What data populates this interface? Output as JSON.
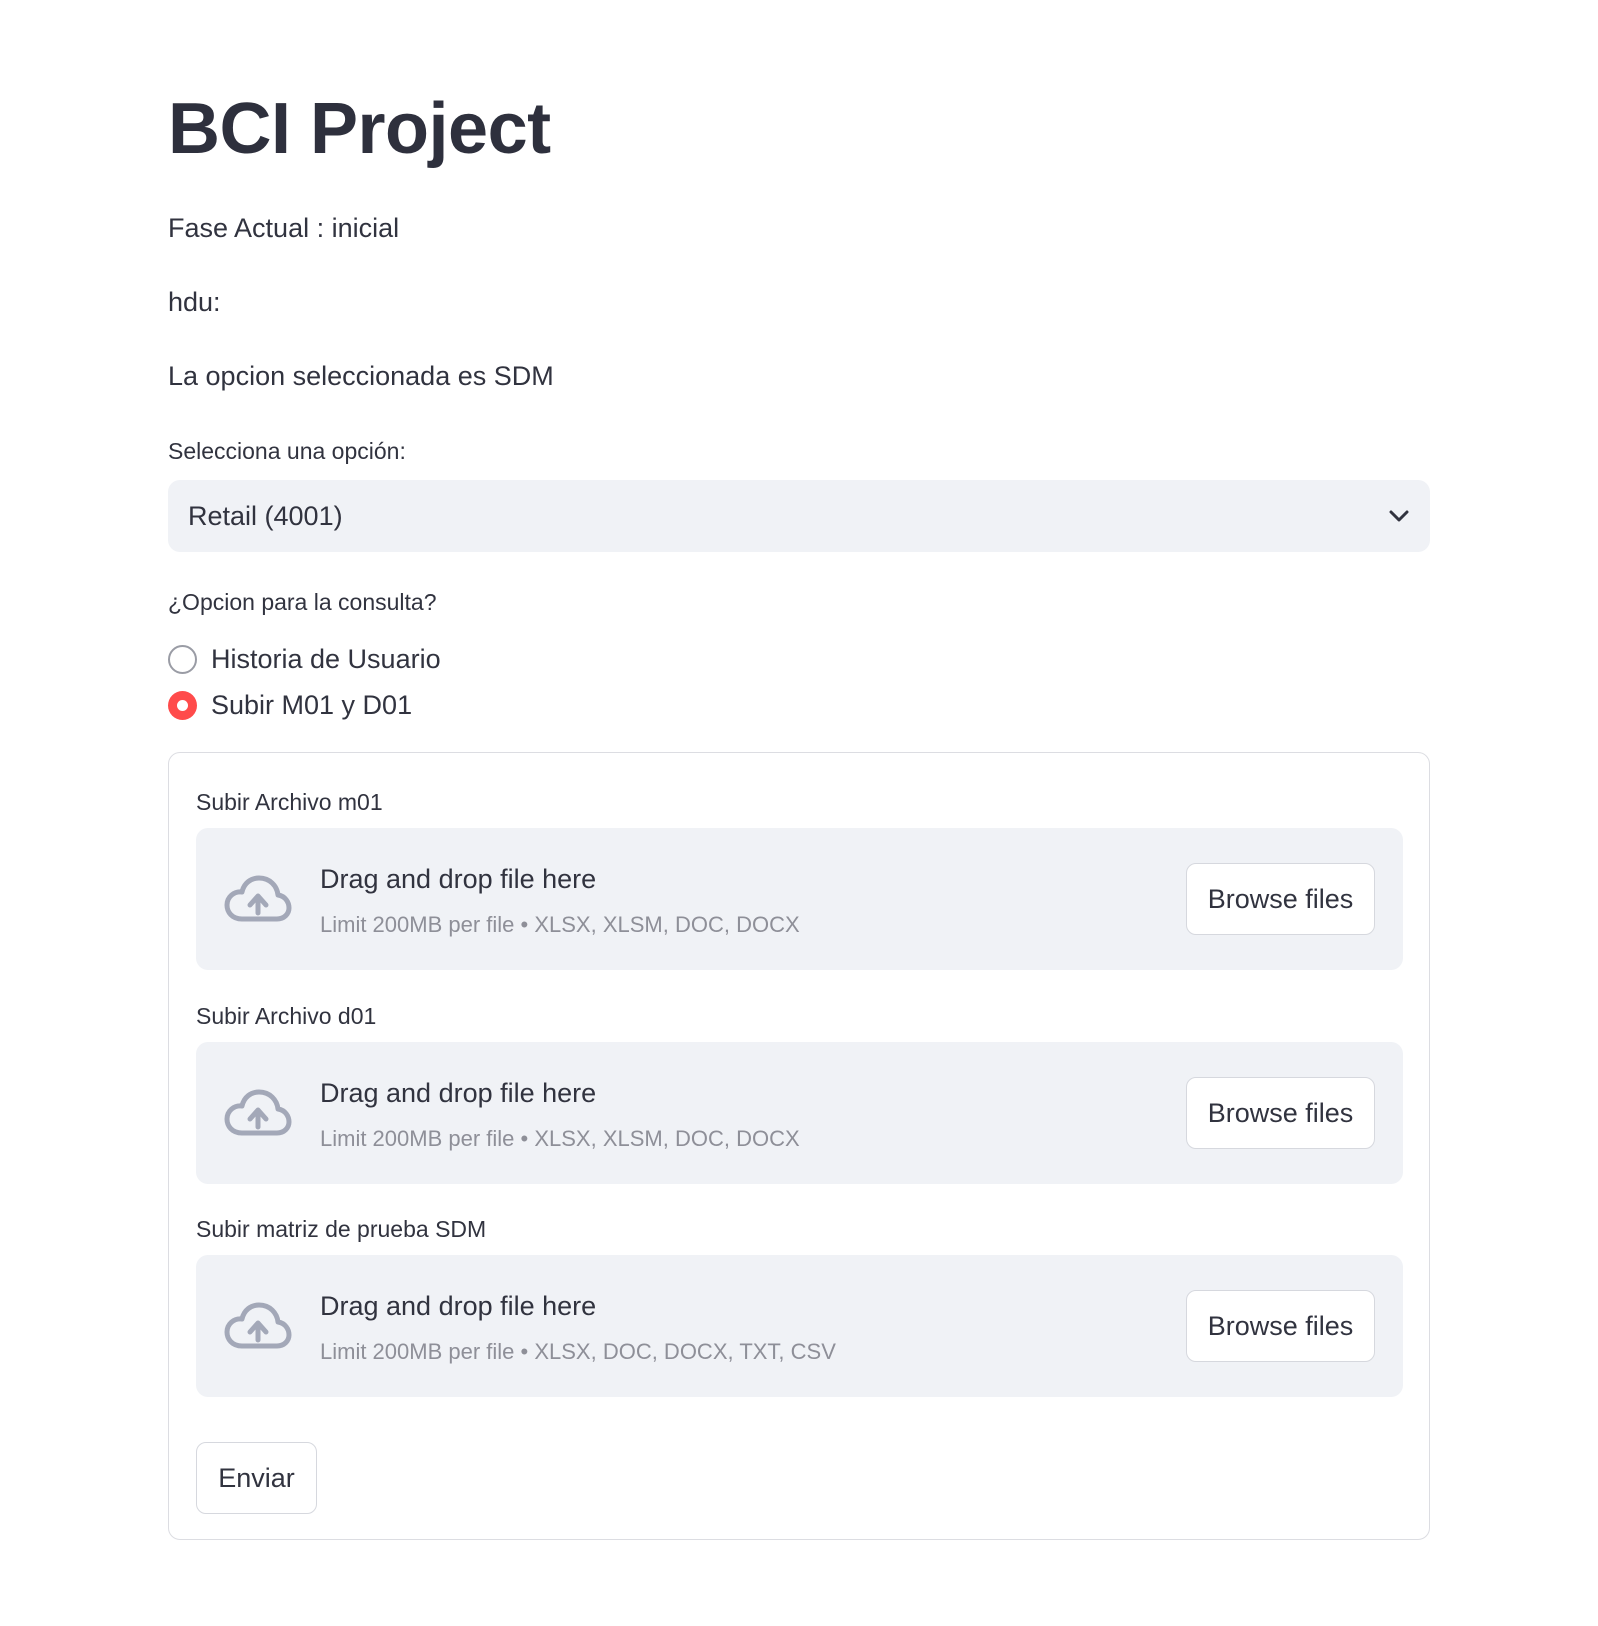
{
  "page": {
    "title": "BCI Project",
    "phase_text": "Fase Actual : inicial",
    "hdu_text": "hdu:",
    "selected_text": "La opcion seleccionada es SDM"
  },
  "select": {
    "label": "Selecciona una opción:",
    "value": "Retail (4001)",
    "icon": "chevron-down-icon"
  },
  "radio": {
    "label": "¿Opcion para la consulta?",
    "options": [
      {
        "label": "Historia de Usuario",
        "checked": false
      },
      {
        "label": "Subir M01 y D01",
        "checked": true
      }
    ]
  },
  "form": {
    "uploaders": [
      {
        "label": "Subir Archivo m01",
        "title": "Drag and drop file here",
        "limit": "Limit 200MB per file • XLSX, XLSM, DOC, DOCX",
        "button": "Browse files",
        "icon": "cloud-upload-icon"
      },
      {
        "label": "Subir Archivo d01",
        "title": "Drag and drop file here",
        "limit": "Limit 200MB per file • XLSX, XLSM, DOC, DOCX",
        "button": "Browse files",
        "icon": "cloud-upload-icon"
      },
      {
        "label": "Subir matriz de prueba SDM",
        "title": "Drag and drop file here",
        "limit": "Limit 200MB per file • XLSX, DOC, DOCX, TXT, CSV",
        "button": "Browse files",
        "icon": "cloud-upload-icon"
      }
    ],
    "submit": "Enviar"
  },
  "colors": {
    "accent": "#ff4b4b",
    "input_bg": "#f0f2f6",
    "text": "#31333f",
    "muted": "#8e8f98",
    "icon": "#a3a8b8"
  }
}
